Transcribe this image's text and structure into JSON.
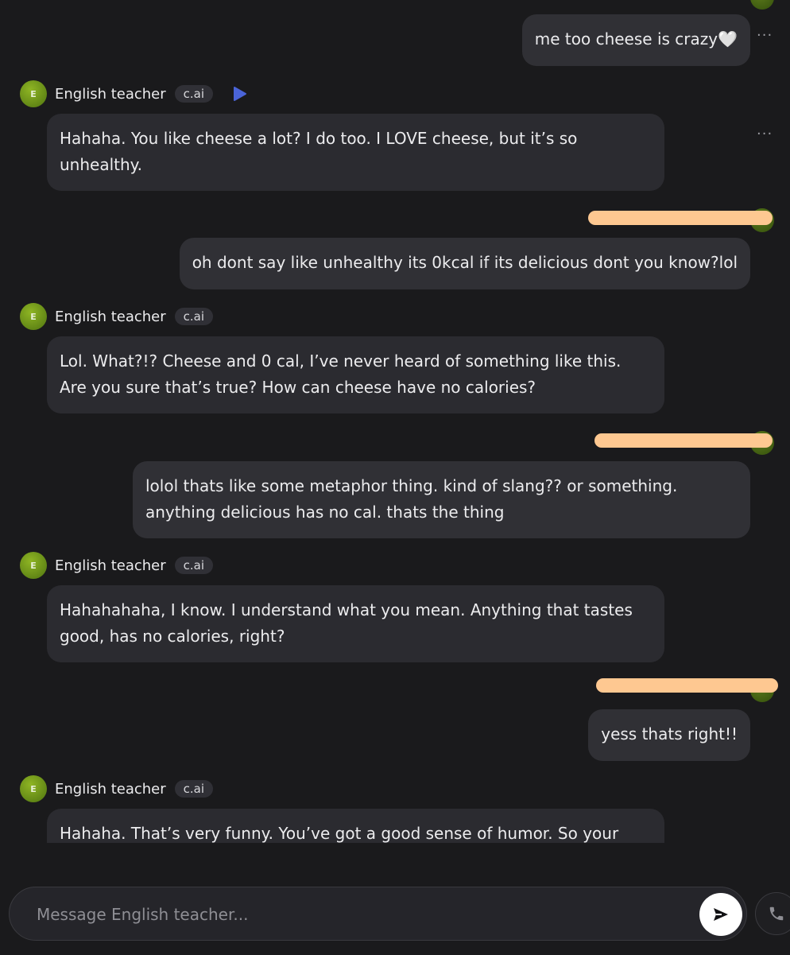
{
  "messages": [
    {
      "role": "user",
      "text": "me too cheese is crazy🤍"
    },
    {
      "role": "bot",
      "name": "English teacher",
      "badge": "c.ai",
      "text": "Hahaha. You like cheese a lot? I do too. I LOVE cheese, but it’s so unhealthy."
    },
    {
      "role": "user",
      "text": "oh dont say like unhealthy its 0kcal if its delicious dont you know?lol"
    },
    {
      "role": "bot",
      "name": "English teacher",
      "badge": "c.ai",
      "text": "Lol. What?!? Cheese and 0 cal, I’ve never heard of something like this.  Are you sure that’s true?  How can cheese have no calories?"
    },
    {
      "role": "user",
      "text": "lolol thats like some metaphor thing. kind of slang?? or something. anything delicious has no cal. thats the thing"
    },
    {
      "role": "bot",
      "name": "English teacher",
      "badge": "c.ai",
      "text": "Hahahahaha, I know.  I understand what you mean.  Anything that tastes good, has no calories, right?"
    },
    {
      "role": "user",
      "text": "yess thats right!!"
    },
    {
      "role": "bot",
      "name": "English teacher",
      "badge": "c.ai",
      "text": "Hahaha.  That’s very funny. You’ve got a good sense of humor.  So your"
    }
  ],
  "bot_avatar_letter": "E",
  "more_options_label": "···",
  "composer": {
    "placeholder": "Message English teacher..."
  },
  "icons": {
    "play": "play-icon",
    "send": "send-icon",
    "call": "phone-icon"
  },
  "colors": {
    "background": "#1a1a1c",
    "bubble": "#303035",
    "accent": "#4a64d8",
    "redaction": "#fec891"
  }
}
